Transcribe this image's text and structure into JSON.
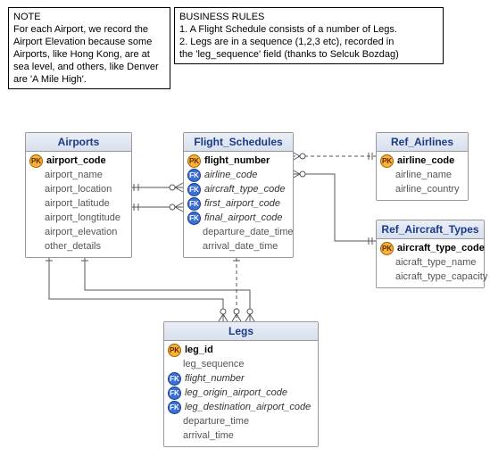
{
  "notes": {
    "left": "NOTE\nFor each Airport, we record the\nAirport Elevation because some\nAirports, like Hong Kong, are at\nsea level, and others, like Denver\nare 'A Mile High'.",
    "right": "BUSINESS RULES\n1.  A Flight Schedule consists of a number of Legs.\n2.  Legs are in a sequence (1,2,3 etc), recorded in\n     the 'leg_sequence' field (thanks to Selcuk Bozdag)"
  },
  "entities": {
    "airports": {
      "title": "Airports",
      "fields": [
        {
          "k": "pk",
          "t": "airport_code"
        },
        {
          "k": "",
          "t": "airport_name"
        },
        {
          "k": "",
          "t": "airport_location"
        },
        {
          "k": "",
          "t": "airport_latitude"
        },
        {
          "k": "",
          "t": "airport_longtitude"
        },
        {
          "k": "",
          "t": "airport_elevation"
        },
        {
          "k": "",
          "t": "other_details"
        }
      ]
    },
    "flight_schedules": {
      "title": "Flight_Schedules",
      "fields": [
        {
          "k": "pk",
          "t": "flight_number"
        },
        {
          "k": "fk",
          "t": "airline_code"
        },
        {
          "k": "fk",
          "t": "aircraft_type_code"
        },
        {
          "k": "fk",
          "t": "first_airport_code"
        },
        {
          "k": "fk",
          "t": "final_airport_code"
        },
        {
          "k": "",
          "t": "departure_date_time"
        },
        {
          "k": "",
          "t": "arrival_date_time"
        }
      ]
    },
    "ref_airlines": {
      "title": "Ref_Airlines",
      "fields": [
        {
          "k": "pk",
          "t": "airline_code"
        },
        {
          "k": "",
          "t": "airline_name"
        },
        {
          "k": "",
          "t": "airline_country"
        }
      ]
    },
    "ref_aircraft_types": {
      "title": "Ref_Aircraft_Types",
      "fields": [
        {
          "k": "pk",
          "t": "aircraft_type_code"
        },
        {
          "k": "",
          "t": "aicraft_type_name"
        },
        {
          "k": "",
          "t": "aicraft_type_capacity"
        }
      ]
    },
    "legs": {
      "title": "Legs",
      "fields": [
        {
          "k": "pk",
          "t": "leg_id"
        },
        {
          "k": "",
          "t": "leg_sequence"
        },
        {
          "k": "fk",
          "t": "flight_number"
        },
        {
          "k": "fk",
          "t": "leg_origin_airport_code"
        },
        {
          "k": "fk",
          "t": "leg_destination_airport_code"
        },
        {
          "k": "",
          "t": "departure_time"
        },
        {
          "k": "",
          "t": "arrival_time"
        }
      ]
    }
  }
}
